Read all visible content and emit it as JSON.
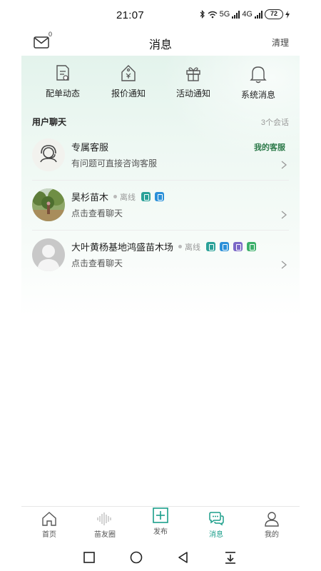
{
  "status_bar": {
    "time": "21:07",
    "bluetooth_icon": "bluetooth-icon",
    "wifi_icon": "wifi-icon",
    "signal_1_label": "5G",
    "signal_2_label": "4G",
    "battery": "72",
    "charging_icon": "charging-icon"
  },
  "header": {
    "title": "消息",
    "clean_label": "清理",
    "mail_icon": "mail-icon",
    "mail_badge": "0"
  },
  "quick_actions": [
    {
      "label": "配单动态",
      "icon": "order-document-icon"
    },
    {
      "label": "报价通知",
      "icon": "quote-price-tag-icon"
    },
    {
      "label": "活动通知",
      "icon": "gift-box-icon"
    },
    {
      "label": "系统消息",
      "icon": "bell-icon"
    }
  ],
  "user_chat": {
    "title": "用户聊天",
    "count": "3个会话"
  },
  "chats": [
    {
      "name": "专属客服",
      "subtitle": "有问题可直接咨询客服",
      "tag": "我的客服",
      "avatar": "customer-service-avatar"
    },
    {
      "name": "昊杉苗木",
      "status": "离线",
      "subtitle": "点击查看聊天",
      "avatar": "tree-photo-avatar"
    },
    {
      "name": "大叶黄杨基地鸿盛苗木场",
      "status": "离线",
      "subtitle": "点击查看聊天",
      "avatar": "default-person-avatar"
    }
  ],
  "tabs": [
    {
      "label": "首页",
      "icon": "home-icon"
    },
    {
      "label": "苗友圈",
      "icon": "soundwave-icon"
    },
    {
      "label": "发布",
      "icon": "publish-plus-icon"
    },
    {
      "label": "消息",
      "icon": "chat-bubbles-icon",
      "active": true
    },
    {
      "label": "我的",
      "icon": "person-icon"
    }
  ],
  "colors": {
    "accent": "#1b9e8a",
    "tag_green": "#2d7a4a",
    "badge_teal": "#2aa198",
    "badge_blue": "#2b90d9",
    "badge_purple": "#7b68c7",
    "badge_green": "#3cb06a"
  }
}
